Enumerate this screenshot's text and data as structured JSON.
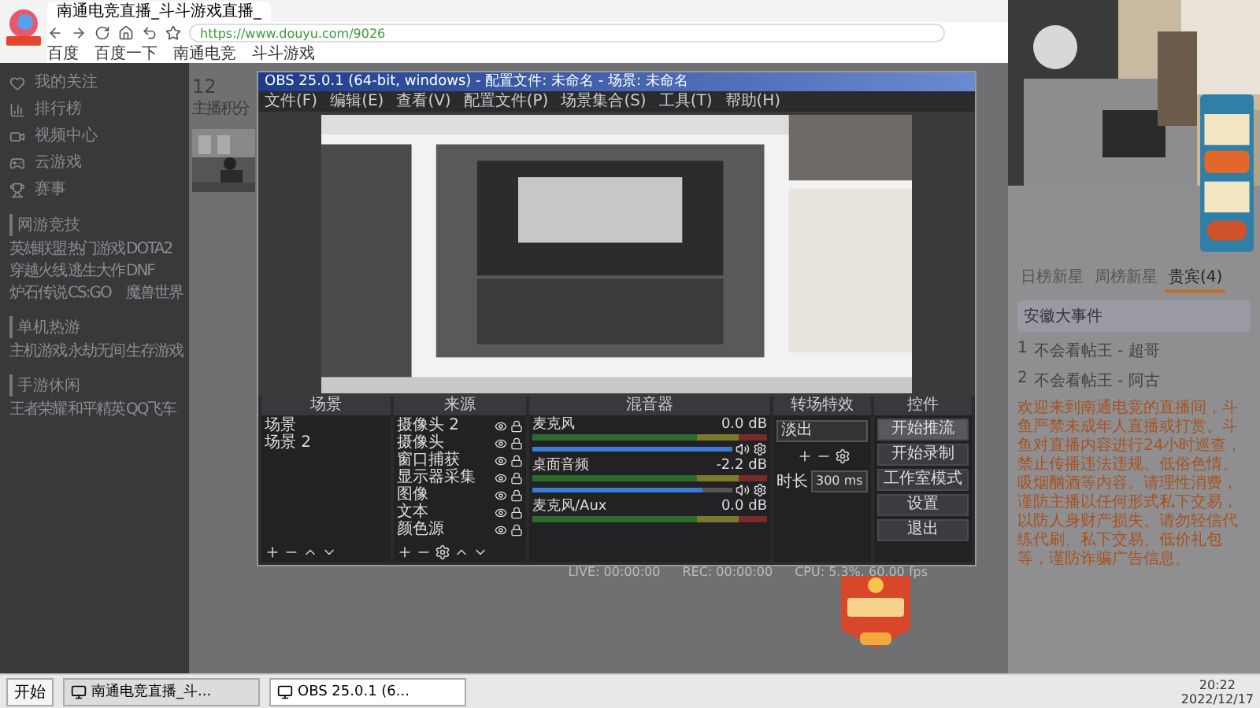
{
  "browser": {
    "tabs": [
      {
        "label": "南通电竞直播_斗斗游戏直播_",
        "selected": true
      }
    ],
    "url": "https://www.douyu.com/9026",
    "bookmarks": [
      "百度",
      "百度一下",
      "南通电竞",
      "斗斗游戏"
    ]
  },
  "site_sidebar": {
    "nav": [
      "我的关注",
      "排行榜",
      "视频中心",
      "云游戏",
      "赛事"
    ],
    "sections": [
      {
        "title": "网游竞技",
        "items": [
          "英雄联盟",
          "热门游戏",
          "DOTA2",
          "穿越火线",
          "逃生大作",
          "DNF",
          "炉石传说",
          "CS:GO",
          "魔兽世界"
        ]
      },
      {
        "title": "单机热游",
        "items": [
          "主机游戏",
          "永劫无间",
          "生存游戏"
        ]
      },
      {
        "title": "手游休闲",
        "items": [
          "王者荣耀",
          "和平精英",
          "QQ飞车"
        ]
      }
    ]
  },
  "room": {
    "score": "12",
    "score_label": "主播积分"
  },
  "obs": {
    "title": "OBS 25.0.1 (64-bit, windows) - 配置文件: 未命名 - 场景: 未命名",
    "menu": [
      "文件(F)",
      "编辑(E)",
      "查看(V)",
      "配置文件(P)",
      "场景集合(S)",
      "工具(T)",
      "帮助(H)"
    ],
    "docks": {
      "scenes": "场景",
      "sources": "来源",
      "mixer": "混音器",
      "transitions": "转场特效",
      "controls": "控件"
    },
    "scenes": [
      {
        "label": "场景",
        "selected": false
      },
      {
        "label": "场景 2",
        "selected": false
      }
    ],
    "sources": [
      {
        "label": "摄像头 2",
        "visible": true
      },
      {
        "label": "摄像头",
        "visible": true
      },
      {
        "label": "窗口捕获",
        "visible": true
      },
      {
        "label": "显示器采集",
        "visible": true
      },
      {
        "label": "图像",
        "visible": true
      },
      {
        "label": "文本",
        "visible": true
      },
      {
        "label": "颜色源",
        "visible": true
      }
    ],
    "mixer": [
      {
        "name": "麦克风",
        "reading": "0.0 dB",
        "level": 1.0
      },
      {
        "name": "桌面音频",
        "reading": "-2.2 dB",
        "level": 0.85
      },
      {
        "name": "麦克风/Aux",
        "reading": "0.0 dB"
      }
    ],
    "transition": {
      "value": "淡出",
      "duration_label": "时长",
      "duration": "300 ms"
    },
    "controls": [
      {
        "label": "开始推流",
        "selected": true
      },
      {
        "label": "开始录制",
        "selected": false
      },
      {
        "label": "工作室模式",
        "selected": false
      },
      {
        "label": "设置",
        "selected": false
      },
      {
        "label": "退出",
        "selected": false
      }
    ],
    "status": [
      "LIVE: 00:00:00",
      "REC: 00:00:00",
      "CPU: 5.3%, 60.00 fps"
    ]
  },
  "right_panel": {
    "tabs": [
      {
        "label": "日榜新星",
        "selected": false
      },
      {
        "label": "周榜新星",
        "selected": false
      },
      {
        "label": "贵宾(4)",
        "selected": true
      }
    ],
    "event": "安徽大事件",
    "ranks": [
      {
        "rank": "1",
        "name": "不会看帖王 - 超哥"
      },
      {
        "rank": "2",
        "name": "不会看帖王 - 阿古"
      }
    ],
    "notice": "欢迎来到南通电竞的直播间，斗鱼严禁未成年人直播或打赏。斗鱼对直播内容进行24小时巡查，禁止传播违法违规、低俗色情、吸烟酗酒等内容。请理性消费，谨防主播以任何形式私下交易，以防人身财产损失。请勿轻信代练代刷、私下交易、低价礼包等，谨防诈骗广告信息。"
  },
  "taskbar": {
    "start": "开始",
    "tasks": [
      {
        "label": "南通电竞直播_斗...",
        "selected": false
      },
      {
        "label": "OBS 25.0.1 (6...",
        "selected": true
      }
    ],
    "time": "20:22",
    "date": "2022/12/17"
  }
}
